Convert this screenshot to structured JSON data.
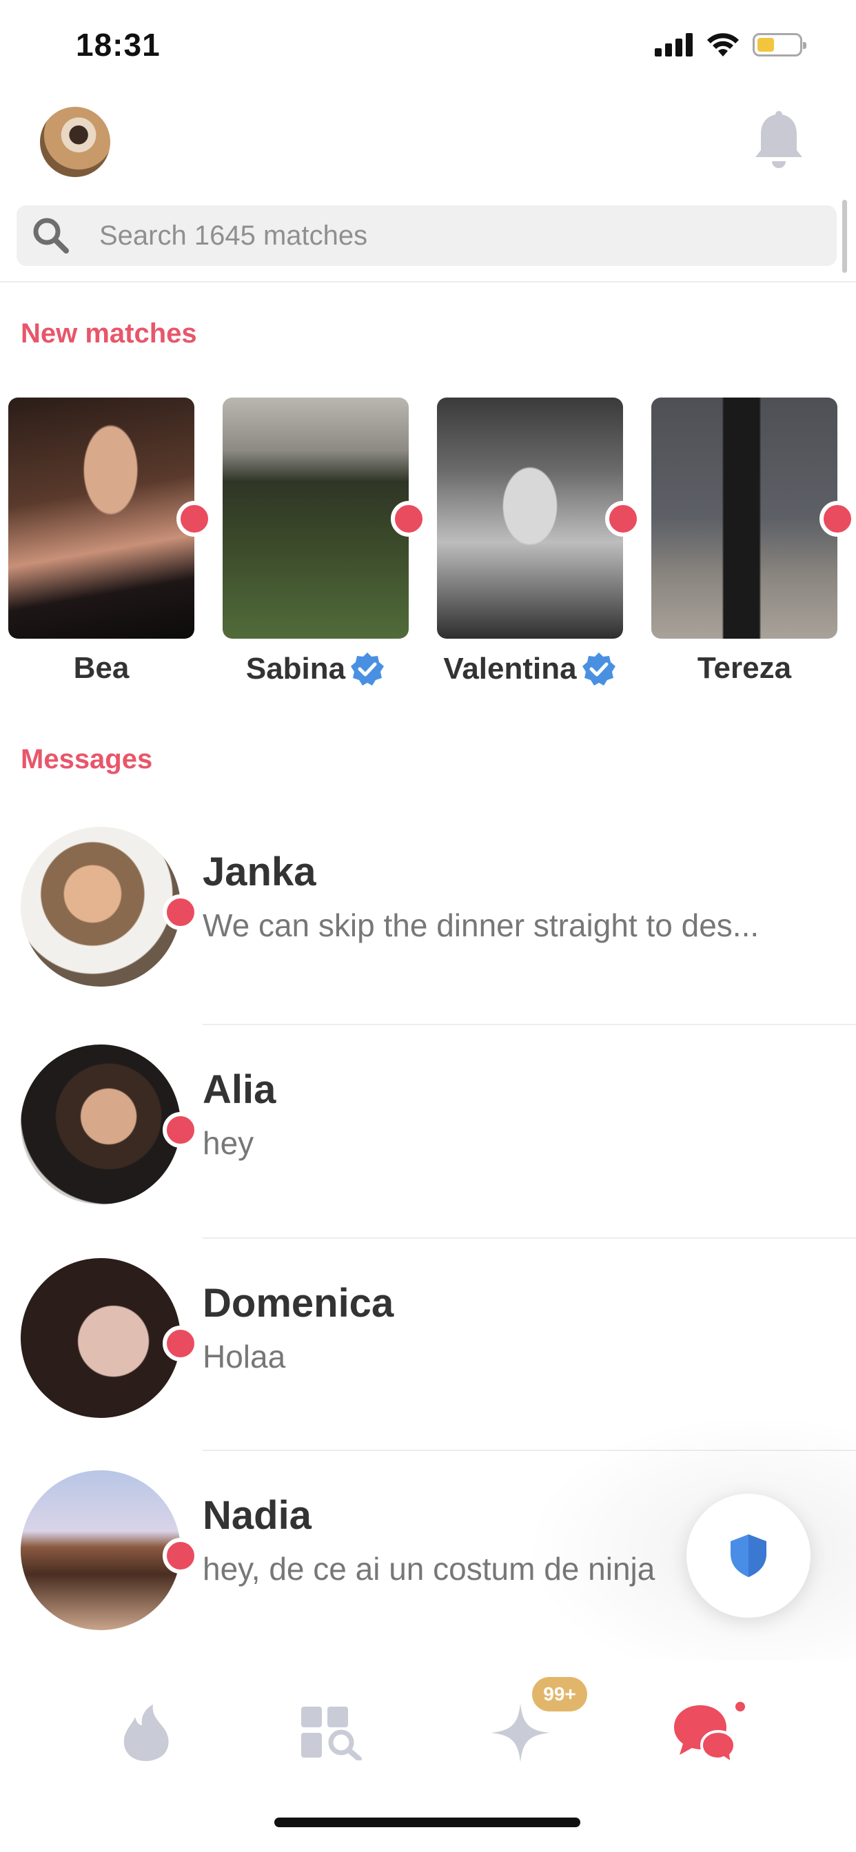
{
  "status_bar": {
    "time": "18:31"
  },
  "search": {
    "placeholder": "Search 1645 matches"
  },
  "sections": {
    "new_matches": "New matches",
    "messages": "Messages"
  },
  "new_matches": [
    {
      "name": "Bea",
      "verified": false
    },
    {
      "name": "Sabina",
      "verified": true
    },
    {
      "name": "Valentina",
      "verified": true
    },
    {
      "name": "Tereza",
      "verified": false
    }
  ],
  "messages": [
    {
      "name": "Janka",
      "preview": "We can skip the dinner straight to des..."
    },
    {
      "name": "Alia",
      "preview": "hey"
    },
    {
      "name": "Domenica",
      "preview": "Holaa"
    },
    {
      "name": "Nadia",
      "preview": "hey, de ce ai un costum de ninja"
    }
  ],
  "tab_bar": {
    "tabs": [
      "flame-icon",
      "explore-icon",
      "likes-sparkle-icon",
      "chat-icon"
    ],
    "badge": "99+"
  },
  "colors": {
    "accent": "#e8566a",
    "unread_dot": "#ea4c5f",
    "verified": "#4a90e2",
    "badge": "#e2b66a"
  }
}
